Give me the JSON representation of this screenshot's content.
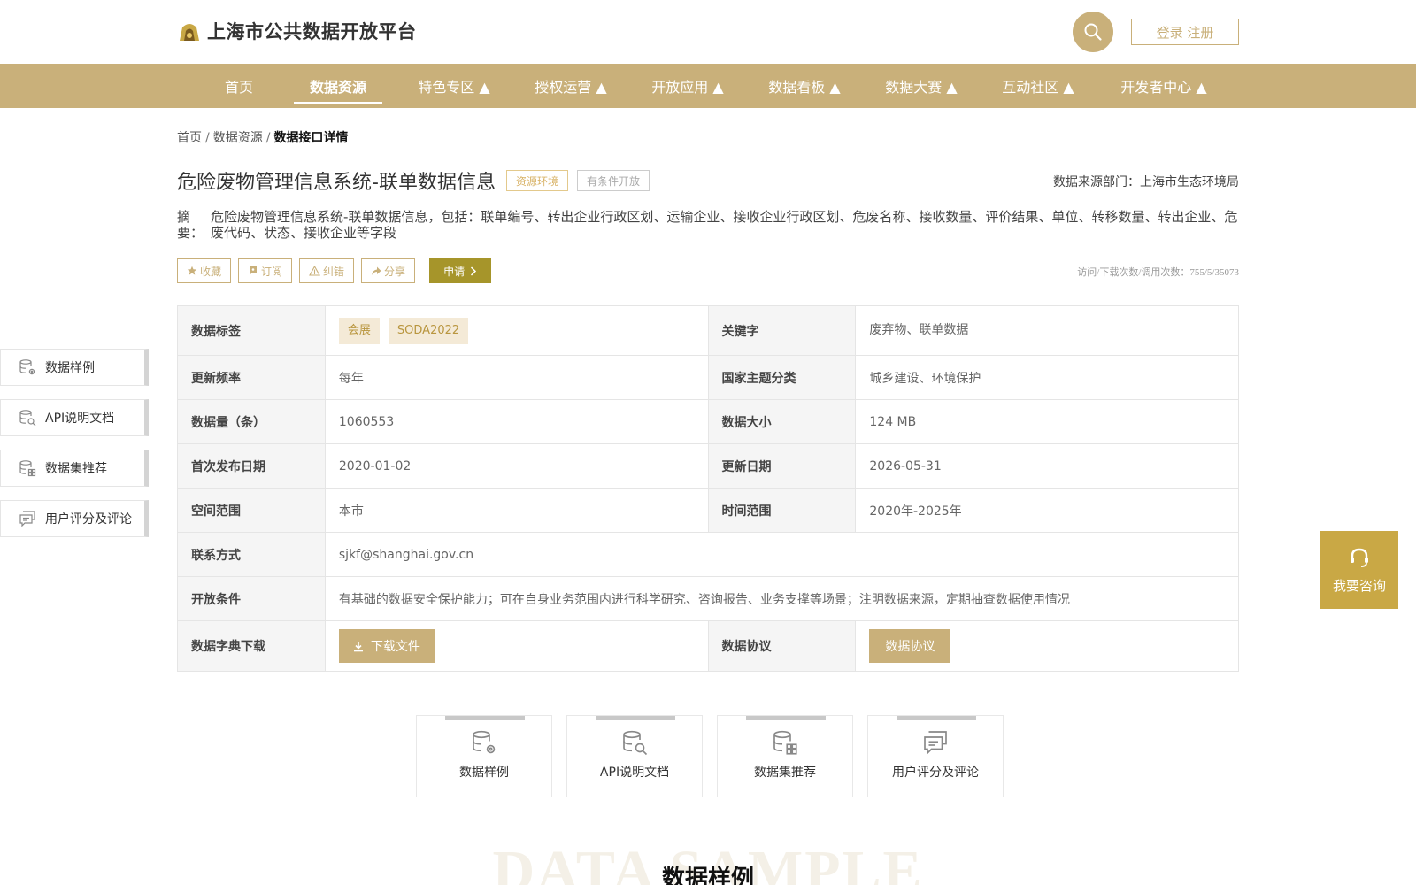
{
  "header": {
    "logo_text": "上海市公共数据开放平台",
    "login_label": "登录 注册"
  },
  "nav": {
    "items": [
      {
        "label": "首页",
        "active": false
      },
      {
        "label": "数据资源",
        "active": true
      },
      {
        "label": "特色专区 ▲",
        "active": false
      },
      {
        "label": "授权运营 ▲",
        "active": false
      },
      {
        "label": "开放应用 ▲",
        "active": false
      },
      {
        "label": "数据看板 ▲",
        "active": false
      },
      {
        "label": "数据大赛 ▲",
        "active": false
      },
      {
        "label": "互动社区 ▲",
        "active": false
      },
      {
        "label": "开发者中心 ▲",
        "active": false
      }
    ]
  },
  "breadcrumb": {
    "items": [
      "首页",
      "数据资源",
      "数据接口详情"
    ],
    "sep": "/"
  },
  "detail": {
    "title": "危险废物管理信息系统-联单数据信息",
    "tag_env": "资源环境",
    "tag_open": "有条件开放",
    "source_dept": "数据来源部门：上海市生态环境局",
    "abstract_label": "摘要：",
    "abstract_text": "危险废物管理信息系统-联单数据信息，包括：联单编号、转出企业行政区划、运输企业、接收企业行政区划、危废名称、接收数量、评价结果、单位、转移数量、转出企业、危废代码、状态、接收企业等字段"
  },
  "actions": {
    "collect": "收藏",
    "subscribe": "订阅",
    "correct": "纠错",
    "share": "分享",
    "apply": "申请",
    "stats": "访问/下载次数/调用次数：755/5/35073"
  },
  "sidenav": {
    "items": [
      {
        "label": "数据样例",
        "icon": "database-gear-icon"
      },
      {
        "label": "API说明文档",
        "icon": "database-search-icon"
      },
      {
        "label": "数据集推荐",
        "icon": "database-grid-icon"
      },
      {
        "label": "用户评分及评论",
        "icon": "comment-icon"
      }
    ]
  },
  "table": {
    "tags_label": "数据标签",
    "tags": [
      "会展",
      "SODA2022"
    ],
    "keywords_label": "关键字",
    "keywords": "废弃物、联单数据",
    "freq_label": "更新频率",
    "freq": "每年",
    "theme_label": "国家主题分类",
    "theme": "城乡建设、环境保护",
    "count_label": "数据量（条）",
    "count": "1060553",
    "size_label": "数据大小",
    "size": "124 MB",
    "first_date_label": "首次发布日期",
    "first_date": "2020-01-02",
    "update_date_label": "更新日期",
    "update_date": "2026-05-31",
    "space_label": "空间范围",
    "space": "本市",
    "time_label": "时间范围",
    "time": "2020年-2025年",
    "contact_label": "联系方式",
    "contact": "sjkf@shanghai.gov.cn",
    "condition_label": "开放条件",
    "condition": "有基础的数据安全保护能力；可在自身业务范围内进行科学研究、咨询报告、业务支撑等场景；注明数据来源，定期抽查数据使用情况",
    "dict_label": "数据字典下载",
    "dict_btn": "下载文件",
    "agree_label": "数据协议",
    "agree_btn": "数据协议"
  },
  "consult": {
    "label": "我要咨询"
  },
  "cards": {
    "items": [
      {
        "label": "数据样例"
      },
      {
        "label": "API说明文档"
      },
      {
        "label": "数据集推荐"
      },
      {
        "label": "用户评分及评论"
      }
    ]
  },
  "section": {
    "watermark": "DATA SAMPLE",
    "title": "数据样例"
  },
  "colors": {
    "gold": "#c9b07a",
    "olive": "#a6952a",
    "consult": "#c9a845"
  }
}
